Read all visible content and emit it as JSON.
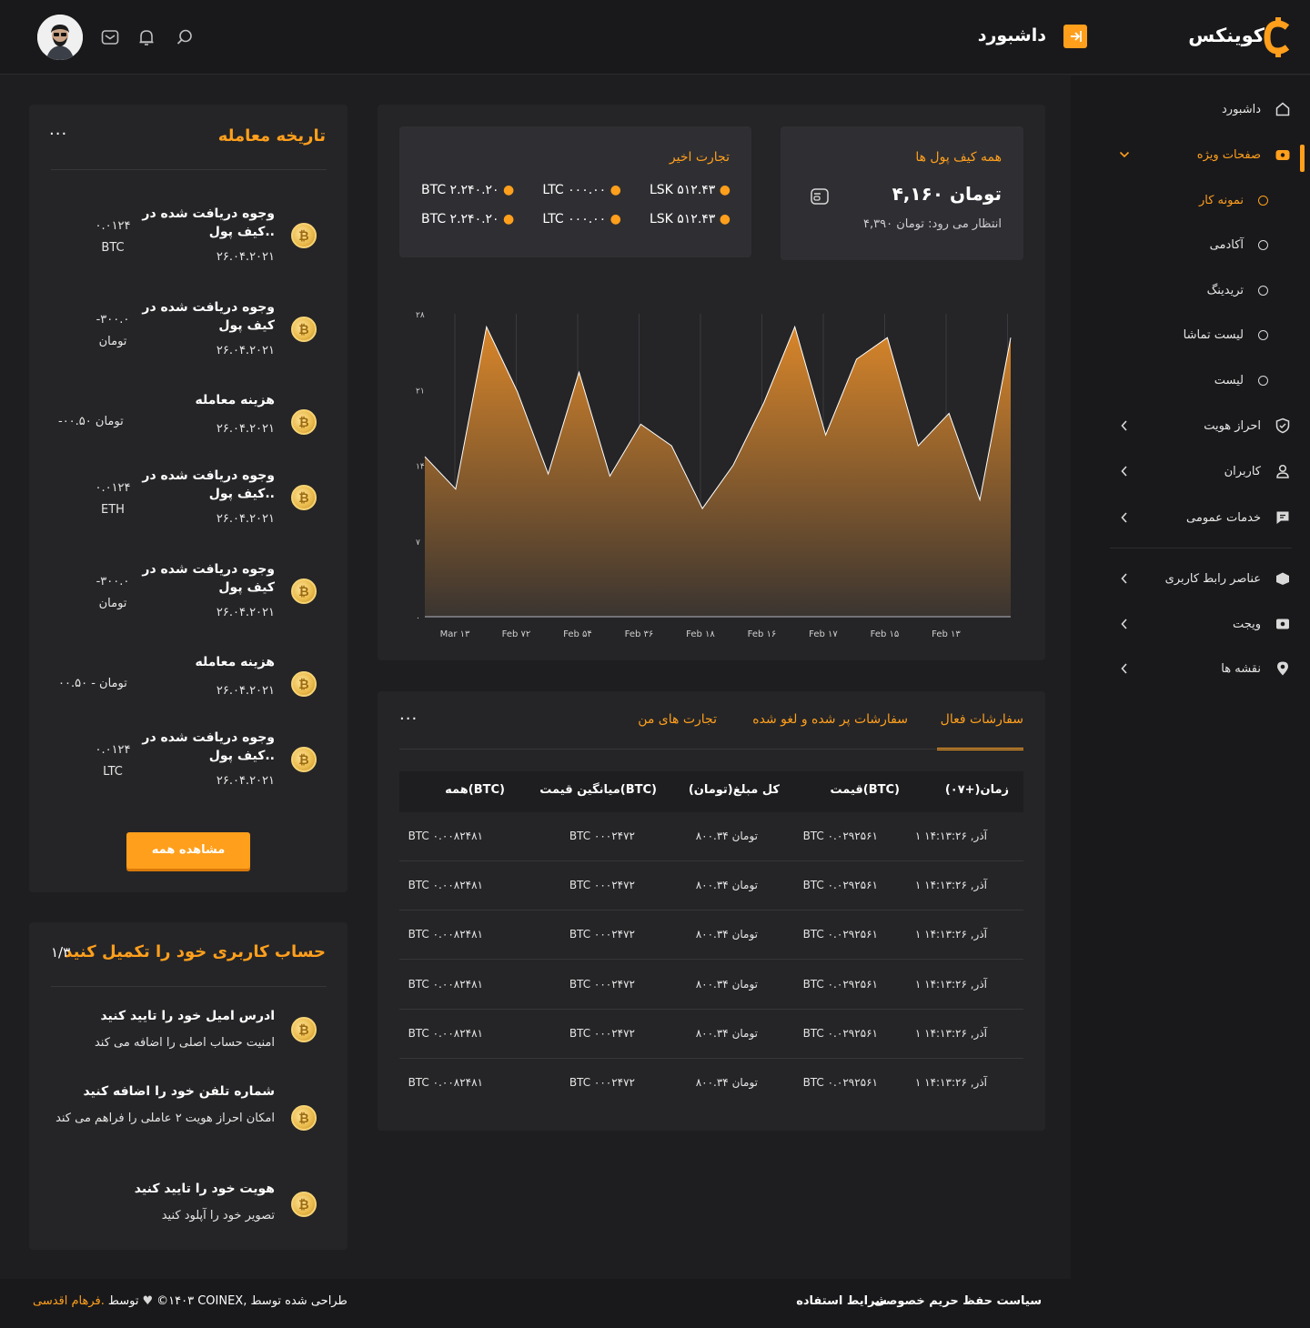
{
  "header": {
    "brand": "کوینکس",
    "page_title": "داشبورد"
  },
  "sidebar": {
    "items": [
      {
        "label": "داشبورد",
        "icon": "home-icon"
      },
      {
        "label": "صفحات ویژه",
        "icon": "gift-icon",
        "active": true
      },
      {
        "label": "احراز هویت",
        "icon": "shield-icon"
      },
      {
        "label": "کاربران",
        "icon": "user-icon"
      },
      {
        "label": "خدمات عمومی",
        "icon": "chat-icon"
      },
      {
        "label": "عناصر رابط کاربری",
        "icon": "box-icon"
      },
      {
        "label": "ویجت",
        "icon": "widget-icon"
      },
      {
        "label": "نقشه ها",
        "icon": "map-pin-icon"
      }
    ],
    "sub_items": [
      {
        "label": "نمونه کار",
        "active": true
      },
      {
        "label": "آکادمی"
      },
      {
        "label": "تریدینگ"
      },
      {
        "label": "لیست تماشا"
      },
      {
        "label": "لیست"
      }
    ]
  },
  "wallet": {
    "title": "همه کیف پول ها",
    "amount": "۴,۱۶۰ تومان",
    "pending": "انتظار می رود: تومان ۴,۳۹۰"
  },
  "recent_trades": {
    "title": "تجارت اخیر",
    "rows": [
      [
        "LSK ۵۱۲.۴۳",
        "LTC ۰۰۰.۰۰",
        "BTC ۲.۲۴۰.۲۰"
      ],
      [
        "LSK ۵۱۲.۴۳",
        "LTC ۰۰۰.۰۰",
        "BTC ۲.۲۴۰.۲۰"
      ]
    ]
  },
  "chart_data": {
    "type": "area",
    "x": [
      "Mar ۱۳",
      "Feb ۷۲",
      "Feb ۵۴",
      "Feb ۳۶",
      "Feb ۱۸",
      "Feb ۱۶",
      "Feb ۱۷",
      "Feb ۱۵",
      "Feb ۱۳"
    ],
    "x_tick_labels": [
      "Mar ۱۳",
      "Feb ۷۲",
      "Feb ۵۴",
      "Feb ۳۶",
      "Feb ۱۸",
      "Feb ۱۶",
      "Feb ۱۷",
      "Feb ۱۵",
      "Feb ۱۳"
    ],
    "y_tick_labels": [
      "۰",
      "۷",
      "۱۴",
      "۲۱",
      "۲۸"
    ],
    "ylim": [
      0,
      28
    ],
    "values": [
      14.8,
      11.8,
      26.8,
      20.8,
      13.2,
      22.6,
      13.0,
      17.8,
      15.8,
      10.0,
      14.0,
      19.8,
      26.8,
      16.8,
      23.8,
      25.8,
      15.8,
      18.8,
      10.8,
      25.8
    ],
    "grid": true,
    "color": "#ff9f1c"
  },
  "orders": {
    "tabs": [
      "سفارشات فعال",
      "سفارشات پر شده و لغو شده",
      "تجارت های من"
    ],
    "columns": [
      "زمان(+۰۷)",
      "قیمت(BTC)",
      "کل مبلغ(تومان)",
      "میانگین قیمت(BTC)",
      "همه(BTC)"
    ],
    "rows": [
      [
        "۱ آذر, ۱۴:۱۳:۲۶",
        "BTC ۰.۰۲۹۲۵۶۱",
        "۸۰۰.۳۴ تومان",
        "BTC ۰۰۰۲۴۷۲",
        "BTC ۰.۰۰۸۲۴۸۱"
      ],
      [
        "۱ آذر, ۱۴:۱۳:۲۶",
        "BTC ۰.۰۲۹۲۵۶۱",
        "۸۰۰.۳۴ تومان",
        "BTC ۰۰۰۲۴۷۲",
        "BTC ۰.۰۰۸۲۴۸۱"
      ],
      [
        "۱ آذر, ۱۴:۱۳:۲۶",
        "BTC ۰.۰۲۹۲۵۶۱",
        "۸۰۰.۳۴ تومان",
        "BTC ۰۰۰۲۴۷۲",
        "BTC ۰.۰۰۸۲۴۸۱"
      ],
      [
        "۱ آذر, ۱۴:۱۳:۲۶",
        "BTC ۰.۰۲۹۲۵۶۱",
        "۸۰۰.۳۴ تومان",
        "BTC ۰۰۰۲۴۷۲",
        "BTC ۰.۰۰۸۲۴۸۱"
      ],
      [
        "۱ آذر, ۱۴:۱۳:۲۶",
        "BTC ۰.۰۲۹۲۵۶۱",
        "۸۰۰.۳۴ تومان",
        "BTC ۰۰۰۲۴۷۲",
        "BTC ۰.۰۰۸۲۴۸۱"
      ],
      [
        "۱ آذر, ۱۴:۱۳:۲۶",
        "BTC ۰.۰۲۹۲۵۶۱",
        "۸۰۰.۳۴ تومان",
        "BTC ۰۰۰۲۴۷۲",
        "BTC ۰.۰۰۸۲۴۸۱"
      ]
    ]
  },
  "history": {
    "title": "تاریخه معامله",
    "items": [
      {
        "title": "وجوه دریافت شده در کیف پول..",
        "date": "۲۶.۰۴.۲۰۲۱",
        "amount": "۰.۰۱۲۴",
        "unit": "BTC"
      },
      {
        "title": "وجوه دریافت شده در کیف پول",
        "date": "۲۶.۰۴.۲۰۲۱",
        "amount": "-۳۰۰.۰",
        "unit": "تومان"
      },
      {
        "title": "هزینه معامله",
        "date": "۲۶.۰۴.۲۰۲۱",
        "amount": "-۰۰.۵۰ تومان",
        "unit": ""
      },
      {
        "title": "وجوه دریافت شده در کیف پول..",
        "date": "۲۶.۰۴.۲۰۲۱",
        "amount": "۰.۰۱۲۴",
        "unit": "ETH"
      },
      {
        "title": "وجوه دریافت شده در کیف پول",
        "date": "۲۶.۰۴.۲۰۲۱",
        "amount": "-۳۰۰.۰",
        "unit": "تومان"
      },
      {
        "title": "هزینه معامله",
        "date": "۲۶.۰۴.۲۰۲۱",
        "amount": "۰۰.۵۰ - تومان",
        "unit": ""
      },
      {
        "title": "وجوه دریافت شده در کیف پول..",
        "date": "۲۶.۰۴.۲۰۲۱",
        "amount": "۰.۰۱۲۴",
        "unit": "LTC"
      }
    ],
    "button": "مشاهده همه"
  },
  "profile": {
    "title": "حساب کاربری خود را تکمیل کنید",
    "progress": "۱/۳",
    "items": [
      {
        "title": "ادرس امیل خود را تایید کنید",
        "desc": "امنیت حساب اصلی را اضافه می کند"
      },
      {
        "title": "شماره تلفن خود را اضافه کنید",
        "desc": "امکان احراز هویت ۲ عاملی را فراهم می کند"
      },
      {
        "title": "هویت خود را تایید کنید",
        "desc": "تصویر خود را آپلود کنید"
      }
    ]
  },
  "footer": {
    "privacy": "سیاست حفظ حریم خصوصی",
    "terms": "شرایط استفاده",
    "credit_text": "©۱۴۰۳ COINEX, طراحی شده توسط",
    "by": "توسط",
    "author": "فرهام اقدسی."
  }
}
